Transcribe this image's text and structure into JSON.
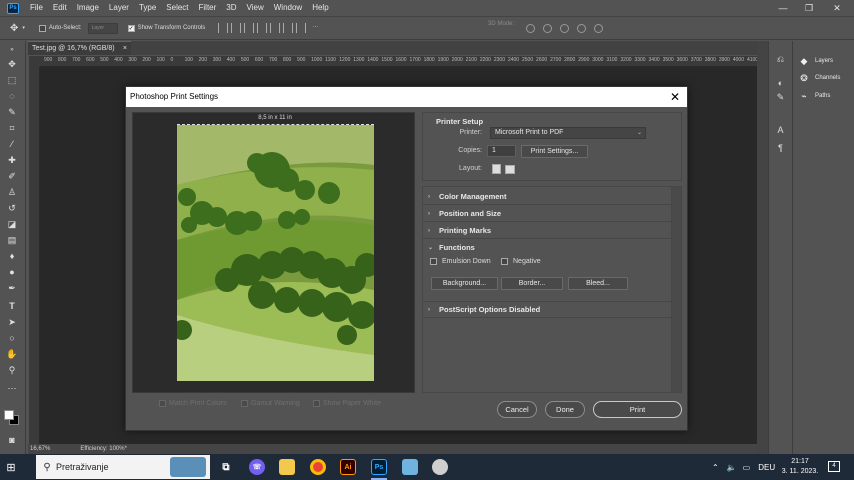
{
  "app": {
    "logo_text": "Ps",
    "menu": [
      "File",
      "Edit",
      "Image",
      "Layer",
      "Type",
      "Select",
      "Filter",
      "3D",
      "View",
      "Window",
      "Help"
    ],
    "window_controls": {
      "minimize": "—",
      "restore": "❐",
      "close": "✕"
    }
  },
  "options_bar": {
    "auto_select_label": "Auto-Select:",
    "auto_select_value": "Layer",
    "show_transform_label": "Show Transform Controls",
    "mode_3d_label": "3D Mode:"
  },
  "document": {
    "tab_title": "Test.jpg @ 16,7% (RGB/8)",
    "tab_close": "×",
    "ruler_ticks": [
      "900",
      "800",
      "700",
      "600",
      "500",
      "400",
      "300",
      "200",
      "100",
      "0",
      "100",
      "200",
      "300",
      "400",
      "500",
      "600",
      "700",
      "800",
      "900",
      "1000",
      "1100",
      "1200",
      "1300",
      "1400",
      "1500",
      "1600",
      "1700",
      "1800",
      "1900",
      "2000",
      "2100",
      "2200",
      "2300",
      "2400",
      "2500",
      "2600",
      "2700",
      "2800",
      "2900",
      "3000",
      "3100",
      "3200",
      "3300",
      "3400",
      "3500",
      "3600",
      "3700",
      "3800",
      "3900",
      "4000",
      "4100"
    ]
  },
  "status": {
    "zoom": "16,67%",
    "efficiency": "Efficiency: 100%*"
  },
  "panels": {
    "items": [
      {
        "label": "Layers",
        "icon": "layers-icon"
      },
      {
        "label": "Channels",
        "icon": "channels-icon"
      },
      {
        "label": "Paths",
        "icon": "paths-icon"
      }
    ]
  },
  "dialog": {
    "title": "Photoshop Print Settings",
    "close": "✕",
    "paper_size": "8,5 in x 11 in",
    "bottom_checks": [
      {
        "label": "Match Print Colors",
        "checked": false
      },
      {
        "label": "Gamut Warning",
        "checked": false
      },
      {
        "label": "Show Paper White",
        "checked": false
      }
    ],
    "printer_setup": {
      "heading": "Printer Setup",
      "printer_label": "Printer:",
      "printer_value": "Microsoft Print to PDF",
      "copies_label": "Copies:",
      "copies_value": "1",
      "print_settings_button": "Print Settings...",
      "layout_label": "Layout:"
    },
    "sections": [
      {
        "label": "Color Management",
        "expanded": false
      },
      {
        "label": "Position and Size",
        "expanded": false
      },
      {
        "label": "Printing Marks",
        "expanded": false
      },
      {
        "label": "Functions",
        "expanded": true
      },
      {
        "label": "PostScript Options Disabled",
        "expanded": false
      }
    ],
    "functions": {
      "emulsion_down": "Emulsion Down",
      "negative": "Negative",
      "background_button": "Background...",
      "border_button": "Border...",
      "bleed_button": "Bleed..."
    },
    "buttons": {
      "cancel": "Cancel",
      "done": "Done",
      "print": "Print"
    }
  },
  "taskbar": {
    "search_placeholder": "Pretraživanje",
    "language": "DEU",
    "time": "21:17",
    "date": "3. 11. 2023.",
    "notification_count": "4"
  },
  "colors": {
    "ps_bg": "#535353",
    "canvas_bg": "#282828",
    "dialog_title_bg": "#ffffff",
    "taskbar_bg": "#1f2a38",
    "photoshop_blue": "#31a8ff"
  }
}
